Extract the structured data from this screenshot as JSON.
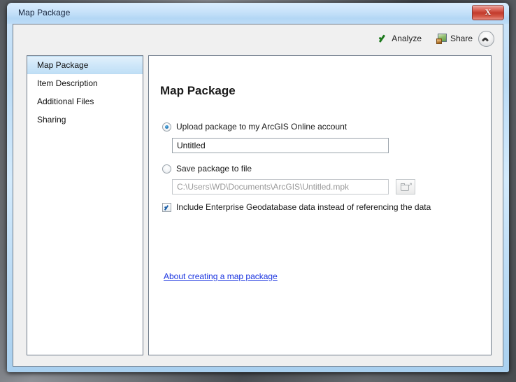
{
  "window": {
    "title": "Map Package",
    "close_label": "X"
  },
  "toolbar": {
    "analyze_label": "Analyze",
    "share_label": "Share",
    "analyze_icon": "check-icon",
    "share_icon": "share-package-icon",
    "collapse_icon": "chevron-up-icon"
  },
  "sidebar": {
    "items": [
      {
        "label": "Map Package",
        "selected": true
      },
      {
        "label": "Item Description",
        "selected": false
      },
      {
        "label": "Additional Files",
        "selected": false
      },
      {
        "label": "Sharing",
        "selected": false
      }
    ]
  },
  "main": {
    "title": "Map Package",
    "upload_option": {
      "label": "Upload package to my ArcGIS Online account",
      "checked": true
    },
    "name_input": {
      "value": "Untitled",
      "placeholder": "Untitled"
    },
    "save_option": {
      "label": "Save package to file",
      "checked": false
    },
    "path_input": {
      "value": "C:\\Users\\WD\\Documents\\ArcGIS\\Untitled.mpk",
      "placeholder": "C:\\Users\\WD\\Documents\\ArcGIS\\Untitled.mpk"
    },
    "browse_button": {
      "label": "",
      "icon": "folder-open-icon"
    },
    "include_checkbox": {
      "label": "Include Enterprise Geodatabase data instead of referencing the data",
      "checked": true
    },
    "about_link": "About creating a map package"
  },
  "colors": {
    "link": "#1b35e0",
    "selection": "#cfe7f9",
    "analyze_check": "#1e7a1e",
    "close_button": "#c23a2b",
    "frame": "#bcdcf6"
  }
}
